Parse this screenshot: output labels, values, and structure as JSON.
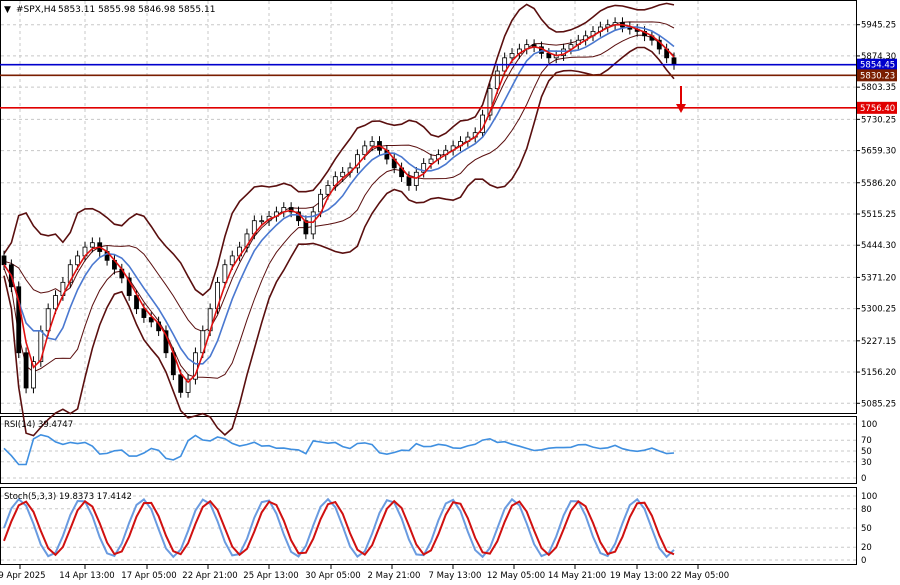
{
  "header": {
    "symbol": "#SPX,H4",
    "ohlc": "5853.11 5855.98 5846.98 5855.11"
  },
  "chart_data": [
    {
      "type": "candlestick",
      "title": "#SPX,H4",
      "ylim": [
        5070,
        5990
      ],
      "y_ticks": [
        "5945.25",
        "5874.30",
        "5803.35",
        "5730.25",
        "5659.30",
        "5586.20",
        "5515.25",
        "5444.30",
        "5371.20",
        "5300.25",
        "5227.15",
        "5156.20",
        "5085.25"
      ],
      "price_lines": [
        {
          "label": "5854.45",
          "value": 5854.45,
          "color": "#0000cc"
        },
        {
          "label": "5830.23",
          "value": 5830.23,
          "color": "#7a1e00"
        },
        {
          "label": "5756.40",
          "value": 5756.4,
          "color": "#e00000"
        }
      ],
      "x_ticks": [
        "9 Apr 2025",
        "14 Apr 13:00",
        "17 Apr 05:00",
        "22 Apr 21:00",
        "25 Apr 13:00",
        "30 Apr 05:00",
        "2 May 21:00",
        "7 May 13:00",
        "12 May 05:00",
        "14 May 21:00",
        "19 May 13:00",
        "22 May 05:00"
      ],
      "closes": [
        5400,
        5350,
        5200,
        5120,
        5180,
        5250,
        5300,
        5330,
        5360,
        5400,
        5420,
        5440,
        5450,
        5430,
        5410,
        5390,
        5370,
        5330,
        5300,
        5280,
        5270,
        5250,
        5200,
        5150,
        5110,
        5140,
        5200,
        5250,
        5300,
        5360,
        5400,
        5420,
        5440,
        5470,
        5500,
        5500,
        5510,
        5520,
        5530,
        5520,
        5500,
        5470,
        5520,
        5560,
        5580,
        5600,
        5610,
        5620,
        5650,
        5670,
        5680,
        5660,
        5640,
        5620,
        5600,
        5580,
        5610,
        5630,
        5640,
        5650,
        5660,
        5670,
        5680,
        5690,
        5700,
        5740,
        5800,
        5840,
        5870,
        5880,
        5890,
        5900,
        5895,
        5880,
        5870,
        5875,
        5890,
        5900,
        5910,
        5920,
        5930,
        5940,
        5945,
        5950,
        5940,
        5935,
        5930,
        5920,
        5910,
        5890,
        5870,
        5855
      ]
    },
    {
      "type": "line",
      "title": "RSI(14) 39.4747",
      "ylim": [
        0,
        100
      ],
      "y_ticks": [
        "100",
        "70",
        "50",
        "30",
        "0"
      ]
    },
    {
      "type": "line",
      "title": "Stoch(5,3,3) 19.8373 17.4142",
      "ylim": [
        0,
        100
      ],
      "y_ticks": [
        "100",
        "80",
        "50",
        "20",
        "0"
      ]
    }
  ]
}
